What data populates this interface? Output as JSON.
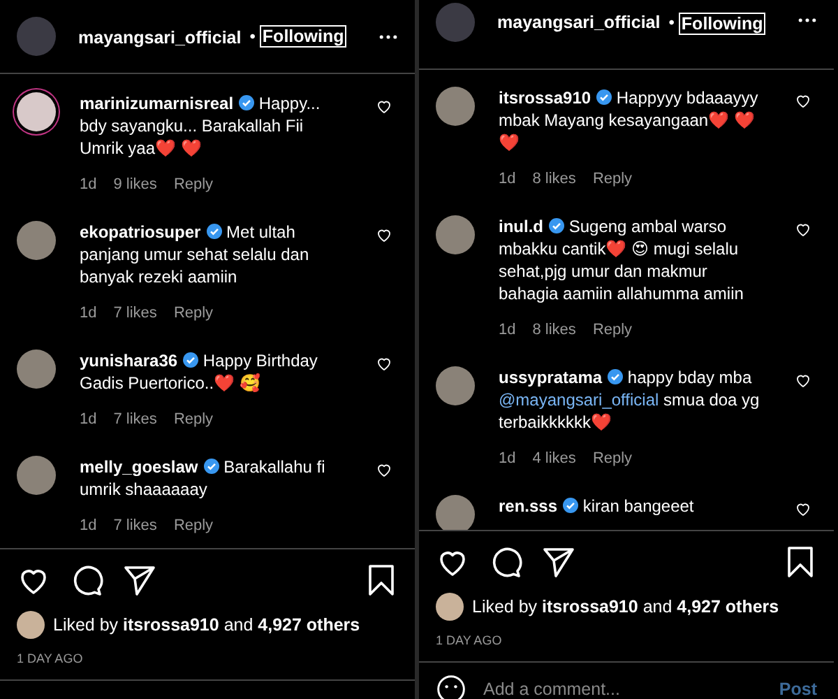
{
  "panels": [
    {
      "header": {
        "username": "mayangsari_official",
        "separator": "•",
        "follow": "Following"
      },
      "comments": [
        {
          "username": "marinizumarnisreal",
          "verified": true,
          "avatar_ring": true,
          "body": [
            {
              "kind": "text",
              "text": "Happy... bdy sayangku... Barakallah Fii Umrik yaa❤️ ❤️"
            }
          ],
          "time": "1d",
          "likes": "9 likes",
          "reply": "Reply"
        },
        {
          "username": "ekopatriosuper",
          "verified": true,
          "avatar_ring": false,
          "body": [
            {
              "kind": "text",
              "text": "Met ultah panjang umur sehat selalu dan banyak rezeki aamiin"
            }
          ],
          "time": "1d",
          "likes": "7 likes",
          "reply": "Reply"
        },
        {
          "username": "yunishara36",
          "verified": true,
          "avatar_ring": false,
          "body": [
            {
              "kind": "text",
              "text": "Happy Birthday Gadis Puertorico..❤️ 🥰"
            }
          ],
          "time": "1d",
          "likes": "7 likes",
          "reply": "Reply"
        },
        {
          "username": "melly_goeslaw",
          "verified": true,
          "avatar_ring": false,
          "body": [
            {
              "kind": "text",
              "text": "Barakallahu fi umrik shaaaaaay"
            }
          ],
          "time": "1d",
          "likes": "7 likes",
          "reply": "Reply"
        }
      ],
      "liked_by": "Liked by **itsrossa910** and **4,927 others**",
      "date": "1 DAY AGO"
    },
    {
      "header": {
        "username": "mayangsari_official",
        "separator": "•",
        "follow": "Following"
      },
      "comments": [
        {
          "username": "itsrossa910",
          "verified": true,
          "avatar_ring": false,
          "body": [
            {
              "kind": "text",
              "text": "Happyyy bdaaayyy mbak Mayang kesayangaan❤️ ❤️ ❤️"
            }
          ],
          "time": "1d",
          "likes": "8 likes",
          "reply": "Reply"
        },
        {
          "username": "inul.d",
          "verified": true,
          "avatar_ring": false,
          "body": [
            {
              "kind": "text",
              "text": "Sugeng ambal warso mbakku cantik❤️ 😍 mugi selalu sehat,pjg umur dan makmur bahagia aamiin allahumma amiin"
            }
          ],
          "time": "1d",
          "likes": "8 likes",
          "reply": "Reply"
        },
        {
          "username": "ussypratama",
          "verified": true,
          "avatar_ring": false,
          "body": [
            {
              "kind": "text",
              "text": "happy bday mba "
            },
            {
              "kind": "mention",
              "text": "@mayangsari_official"
            },
            {
              "kind": "text",
              "text": " smua doa yg terbaikkkkkk❤️"
            }
          ],
          "time": "1d",
          "likes": "4 likes",
          "reply": "Reply"
        },
        {
          "username": "ren.sss",
          "verified": true,
          "avatar_ring": false,
          "body": [
            {
              "kind": "text",
              "text": "kiran bangeeet"
            }
          ]
        }
      ],
      "liked_by": "Liked by **itsrossa910** and **4,927 others**",
      "date": "1 DAY AGO",
      "add_comment": {
        "placeholder": "Add a comment...",
        "post": "Post"
      }
    }
  ]
}
